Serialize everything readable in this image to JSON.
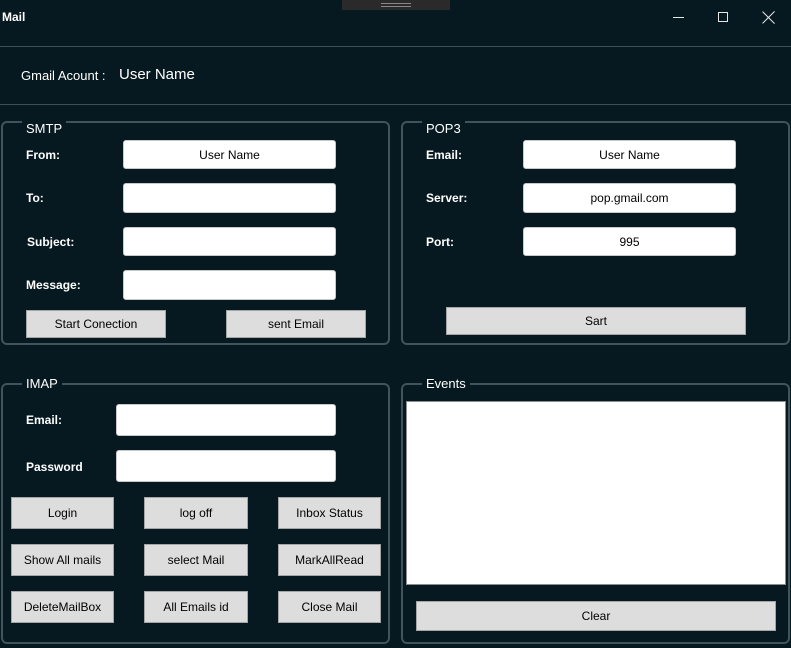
{
  "window": {
    "title": "Mail",
    "controls": {
      "minimize": "minimize-icon",
      "maximize": "maximize-icon",
      "close": "close-icon"
    }
  },
  "account": {
    "label": "Gmail Acount :",
    "value": "User Name"
  },
  "smtp": {
    "legend": "SMTP",
    "from_label": "From:",
    "from_value": "User Name",
    "to_label": "To:",
    "to_value": "",
    "subject_label": "Subject:",
    "subject_value": "",
    "message_label": "Message:",
    "message_value": "",
    "start_button": "Start Conection",
    "send_button": "sent Email"
  },
  "pop3": {
    "legend": "POP3",
    "email_label": "Email:",
    "email_value": "User Name",
    "server_label": "Server:",
    "server_value": "pop.gmail.com",
    "port_label": "Port:",
    "port_value": "995",
    "start_button": "Sart"
  },
  "imap": {
    "legend": "IMAP",
    "email_label": "Email:",
    "email_value": "",
    "password_label": "Password",
    "password_value": "",
    "buttons": {
      "login": "Login",
      "logoff": "log off",
      "inbox_status": "Inbox Status",
      "show_all": "Show All mails",
      "select_mail": "select Mail",
      "mark_all_read": "MarkAllRead",
      "delete_mailbox": "DeleteMailBox",
      "all_ids": "All Emails id",
      "close_mail": "Close Mail"
    }
  },
  "events": {
    "legend": "Events",
    "log_text": "",
    "clear_button": "Clear"
  },
  "colors": {
    "background": "#071920",
    "group_border": "#3f545b",
    "button": "#dddddd",
    "field": "#ffffff"
  }
}
